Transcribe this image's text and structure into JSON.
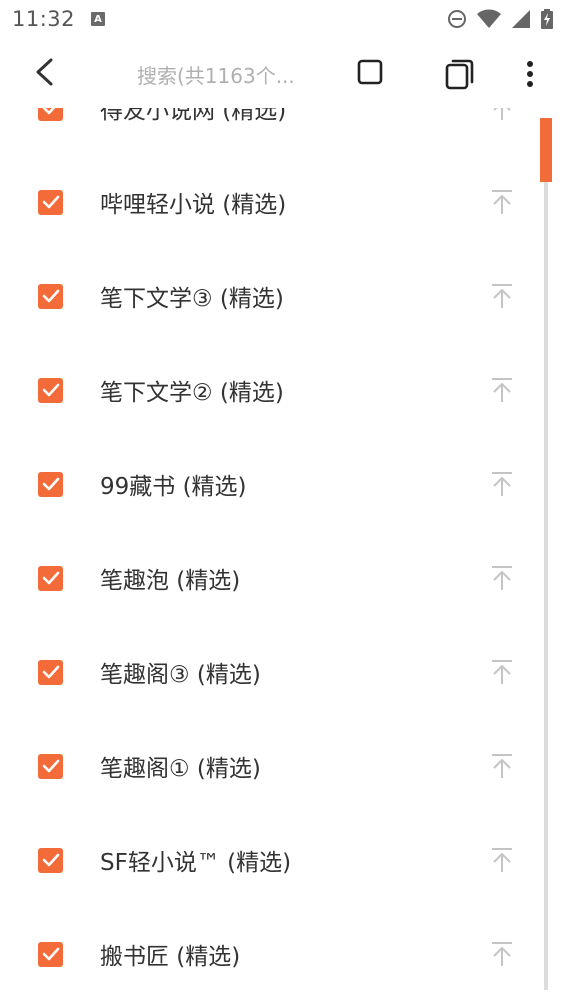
{
  "status_bar": {
    "time": "11:32",
    "notification_icon": "A"
  },
  "app_bar": {
    "search_placeholder": "搜索(共1163个..."
  },
  "list": {
    "items": [
      {
        "label": "得友小说网 (精选)",
        "checked": true
      },
      {
        "label": "哔哩轻小说 (精选)",
        "checked": true
      },
      {
        "label": "笔下文学③ (精选)",
        "checked": true
      },
      {
        "label": "笔下文学② (精选)",
        "checked": true
      },
      {
        "label": "99藏书 (精选)",
        "checked": true
      },
      {
        "label": "笔趣泡 (精选)",
        "checked": true
      },
      {
        "label": "笔趣阁③ (精选)",
        "checked": true
      },
      {
        "label": "笔趣阁① (精选)",
        "checked": true
      },
      {
        "label": "SF轻小说™ (精选)",
        "checked": true
      },
      {
        "label": "搬书匠 (精选)",
        "checked": true
      }
    ]
  },
  "colors": {
    "accent": "#f26b38",
    "text": "#333333",
    "muted": "#b0b0b0"
  }
}
